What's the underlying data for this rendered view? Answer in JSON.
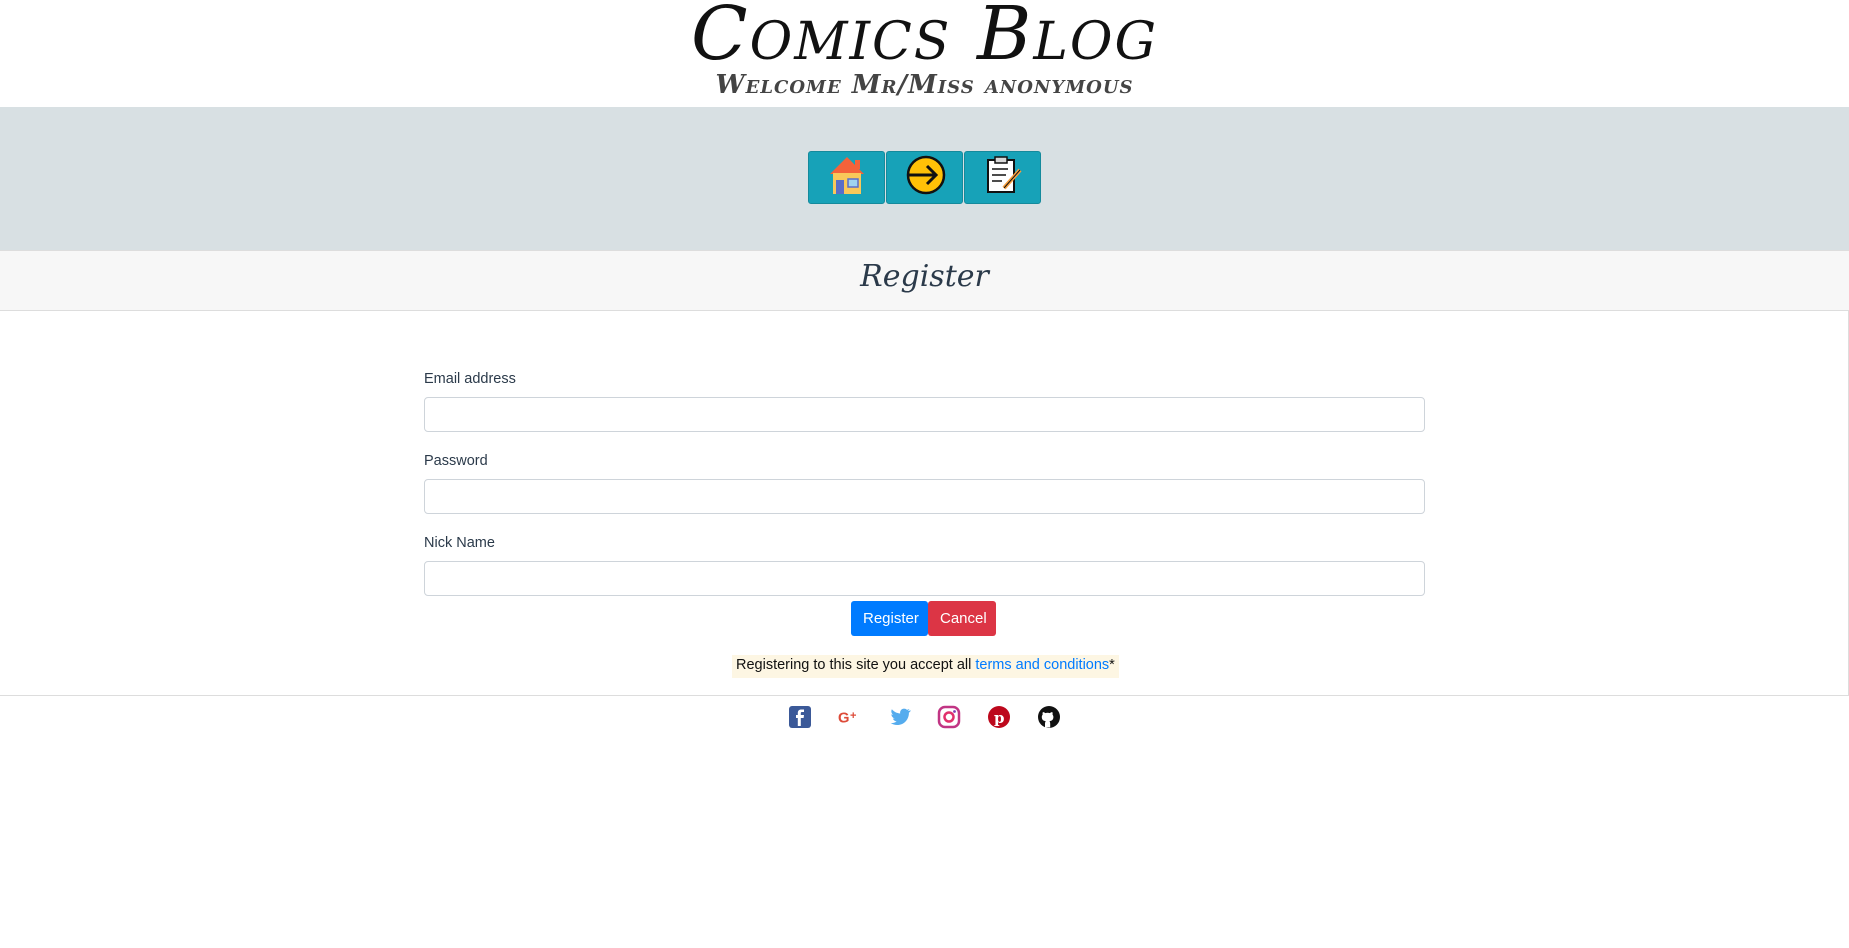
{
  "header": {
    "title": "Comics Blog",
    "welcome": "Welcome Mr/Miss anonymous"
  },
  "nav": {
    "buttons": [
      {
        "icon": "home-icon"
      },
      {
        "icon": "login-icon"
      },
      {
        "icon": "register-icon"
      }
    ]
  },
  "page": {
    "heading": "Register"
  },
  "form": {
    "email_label": "Email address",
    "email_value": "",
    "password_label": "Password",
    "password_value": "",
    "nickname_label": "Nick Name",
    "nickname_value": "",
    "register_button": "Register",
    "cancel_button": "Cancel"
  },
  "terms": {
    "text": "Registering to this site you accept all ",
    "link": "terms and conditions",
    "suffix": "*"
  },
  "footer": {
    "social": [
      "facebook-icon",
      "google-plus-icon",
      "twitter-icon",
      "instagram-icon",
      "pinterest-icon",
      "github-icon"
    ]
  },
  "colors": {
    "nav_button": "#17a2b8",
    "primary": "#007bff",
    "danger": "#dc3545"
  }
}
